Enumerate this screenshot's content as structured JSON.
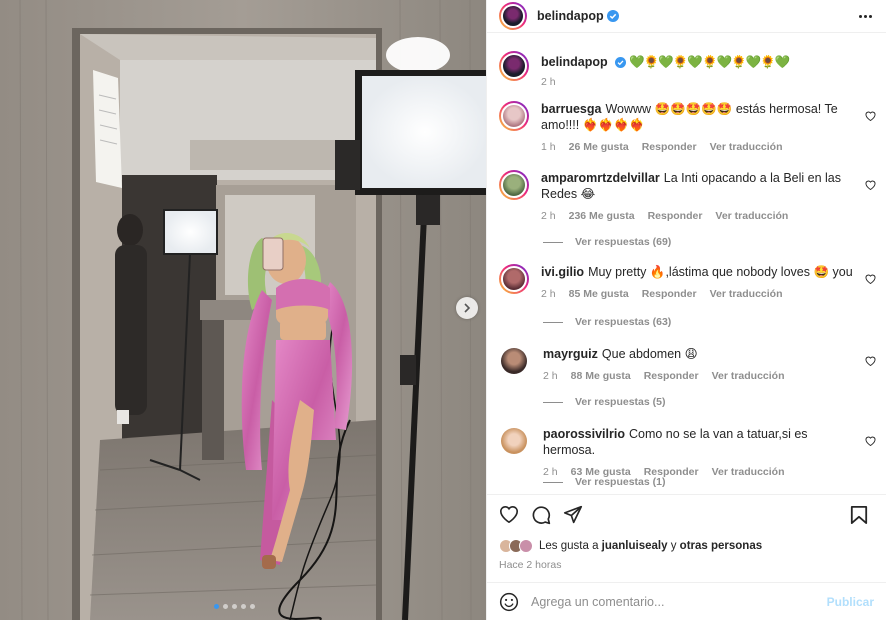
{
  "post": {
    "author": "belindapop",
    "caption_emojis": "💚🌻💚🌻💚🌻💚🌻💚🌻💚",
    "caption_time": "2 h",
    "slide_count": 5,
    "active_slide": 1
  },
  "comments": [
    {
      "username": "barruesga",
      "text": "Wowww 🤩🤩🤩🤩🤩 estás hermosa! Te amo!!!! ❤️‍🔥❤️‍🔥❤️‍🔥❤️‍🔥",
      "time": "1 h",
      "likes": "26 Me gusta",
      "reply": "Responder",
      "translate": "Ver traducción",
      "view_replies": ""
    },
    {
      "username": "amparomrtzdelvillar",
      "text": "La Inti opacando a la Beli en las Redes 😂",
      "time": "2 h",
      "likes": "236 Me gusta",
      "reply": "Responder",
      "translate": "Ver traducción",
      "view_replies": "Ver respuestas (69)"
    },
    {
      "username": "ivi.gilio",
      "text": "Muy pretty 🔥,lástima que nobody loves 🤩 you",
      "time": "2 h",
      "likes": "85 Me gusta",
      "reply": "Responder",
      "translate": "Ver traducción",
      "view_replies": "Ver respuestas (63)"
    },
    {
      "username": "mayrguiz",
      "text": "Que abdomen 😩",
      "time": "2 h",
      "likes": "88 Me gusta",
      "reply": "Responder",
      "translate": "Ver traducción",
      "view_replies": "Ver respuestas (5)"
    },
    {
      "username": "paorossivilrio",
      "text": "Como no se la van a tatuar,si es hermosa.",
      "time": "2 h",
      "likes": "63 Me gusta",
      "reply": "Responder",
      "translate": "Ver traducción",
      "view_replies": "Ver respuestas (1)"
    }
  ],
  "likes": {
    "prefix": "Les gusta a",
    "user": "juanluisealy",
    "and": "y",
    "others": "otras personas"
  },
  "time_ago": "Hace 2 horas",
  "add_comment": {
    "placeholder": "Agrega un comentario...",
    "publish": "Publicar"
  },
  "icons": {
    "verified": "verified-badge-icon",
    "more": "more-options-icon",
    "like": "heart-icon",
    "comment": "comment-icon",
    "share": "send-icon",
    "save": "bookmark-icon",
    "emoji": "emoji-icon",
    "next": "chevron-right-icon"
  },
  "colors": {
    "verified": "#3897f0",
    "text_primary": "#262626",
    "text_secondary": "#8e8e8e",
    "publish_disabled": "#b2dffc",
    "outfit_pink": "#d46fb0"
  }
}
